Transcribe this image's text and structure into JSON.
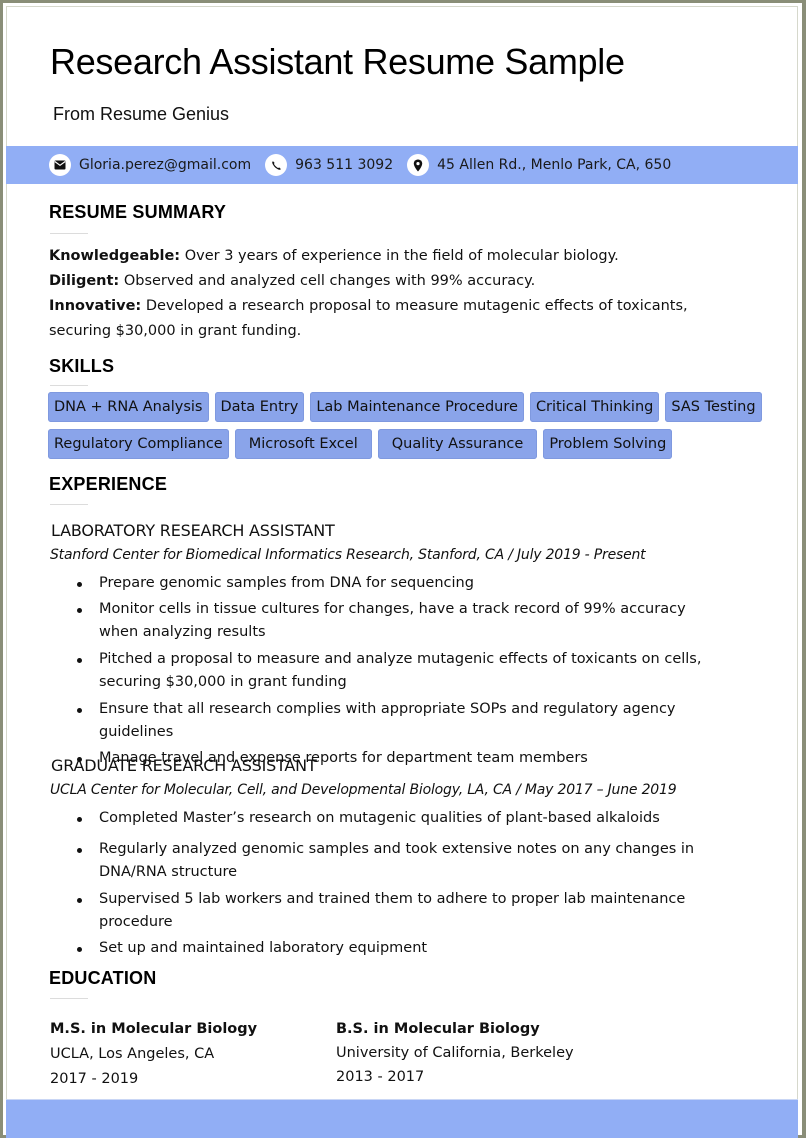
{
  "header": {
    "title": "Research Assistant Resume Sample",
    "subtitle": "From Resume Genius"
  },
  "contact": {
    "email": {
      "icon": "envelope-icon",
      "text": "Gloria.perez@gmail.com"
    },
    "phone": {
      "icon": "phone-icon",
      "text": "963 511 3092"
    },
    "address": {
      "icon": "map-pin-icon",
      "text": "45 Allen Rd., Menlo Park, CA, 650"
    }
  },
  "colors": {
    "band": "#91aef5",
    "chip": "#8aa4ea",
    "frame": "#8a8e78"
  },
  "summary": {
    "heading": "RESUME SUMMARY",
    "items": [
      {
        "label": "Knowledgeable:",
        "text": " Over 3 years of experience in the field of molecular biology."
      },
      {
        "label": "Diligent:",
        "text": " Observed and analyzed cell changes with 99% accuracy."
      },
      {
        "label": "Innovative:",
        "text": " Developed a research proposal to measure mutagenic effects of toxicants, securing $30,000 in grant funding."
      }
    ]
  },
  "skills": {
    "heading": "SKILLS",
    "rows": [
      [
        "DNA + RNA Analysis",
        "Data Entry",
        "Lab Maintenance Procedure",
        "Critical Thinking",
        "SAS Testing"
      ],
      [
        "Regulatory Compliance",
        "Microsoft Excel",
        "Quality Assurance",
        "Problem Solving"
      ]
    ]
  },
  "experience": {
    "heading": "EXPERIENCE",
    "jobs": [
      {
        "title": "LABORATORY RESEARCH ASSISTANT",
        "subtitle": "Stanford Center for Biomedical Informatics Research, Stanford, CA / July 2019 - Present",
        "bullets": [
          "Prepare genomic samples from DNA for sequencing",
          "Monitor cells in tissue cultures for changes, have a track record of 99% accuracy when analyzing results",
          "Pitched a proposal to measure and analyze mutagenic effects of toxicants on cells, securing $30,000 in grant funding",
          "Ensure that all research complies with appropriate SOPs and regulatory agency guidelines",
          "Manage travel and expense reports for department team members"
        ]
      },
      {
        "title": "GRADUATE RESEARCH ASSISTANT",
        "subtitle": "UCLA Center for Molecular, Cell, and Developmental Biology, LA, CA / May 2017 – June 2019",
        "bullets": [
          "Completed Master’s research on mutagenic qualities of plant-based alkaloids",
          "Regularly analyzed genomic samples and took extensive notes on any changes in DNA/RNA structure",
          "Supervised 5 lab workers and trained them to adhere to proper lab maintenance procedure",
          "Set up and maintained laboratory equipment"
        ]
      }
    ]
  },
  "education": {
    "heading": "EDUCATION",
    "entries": [
      {
        "degree": "M.S. in Molecular Biology",
        "school": "UCLA, Los Angeles, CA",
        "years": "2017 - 2019"
      },
      {
        "degree": "B.S. in Molecular Biology",
        "school": "University of California, Berkeley",
        "years": "2013 - 2017"
      }
    ]
  }
}
